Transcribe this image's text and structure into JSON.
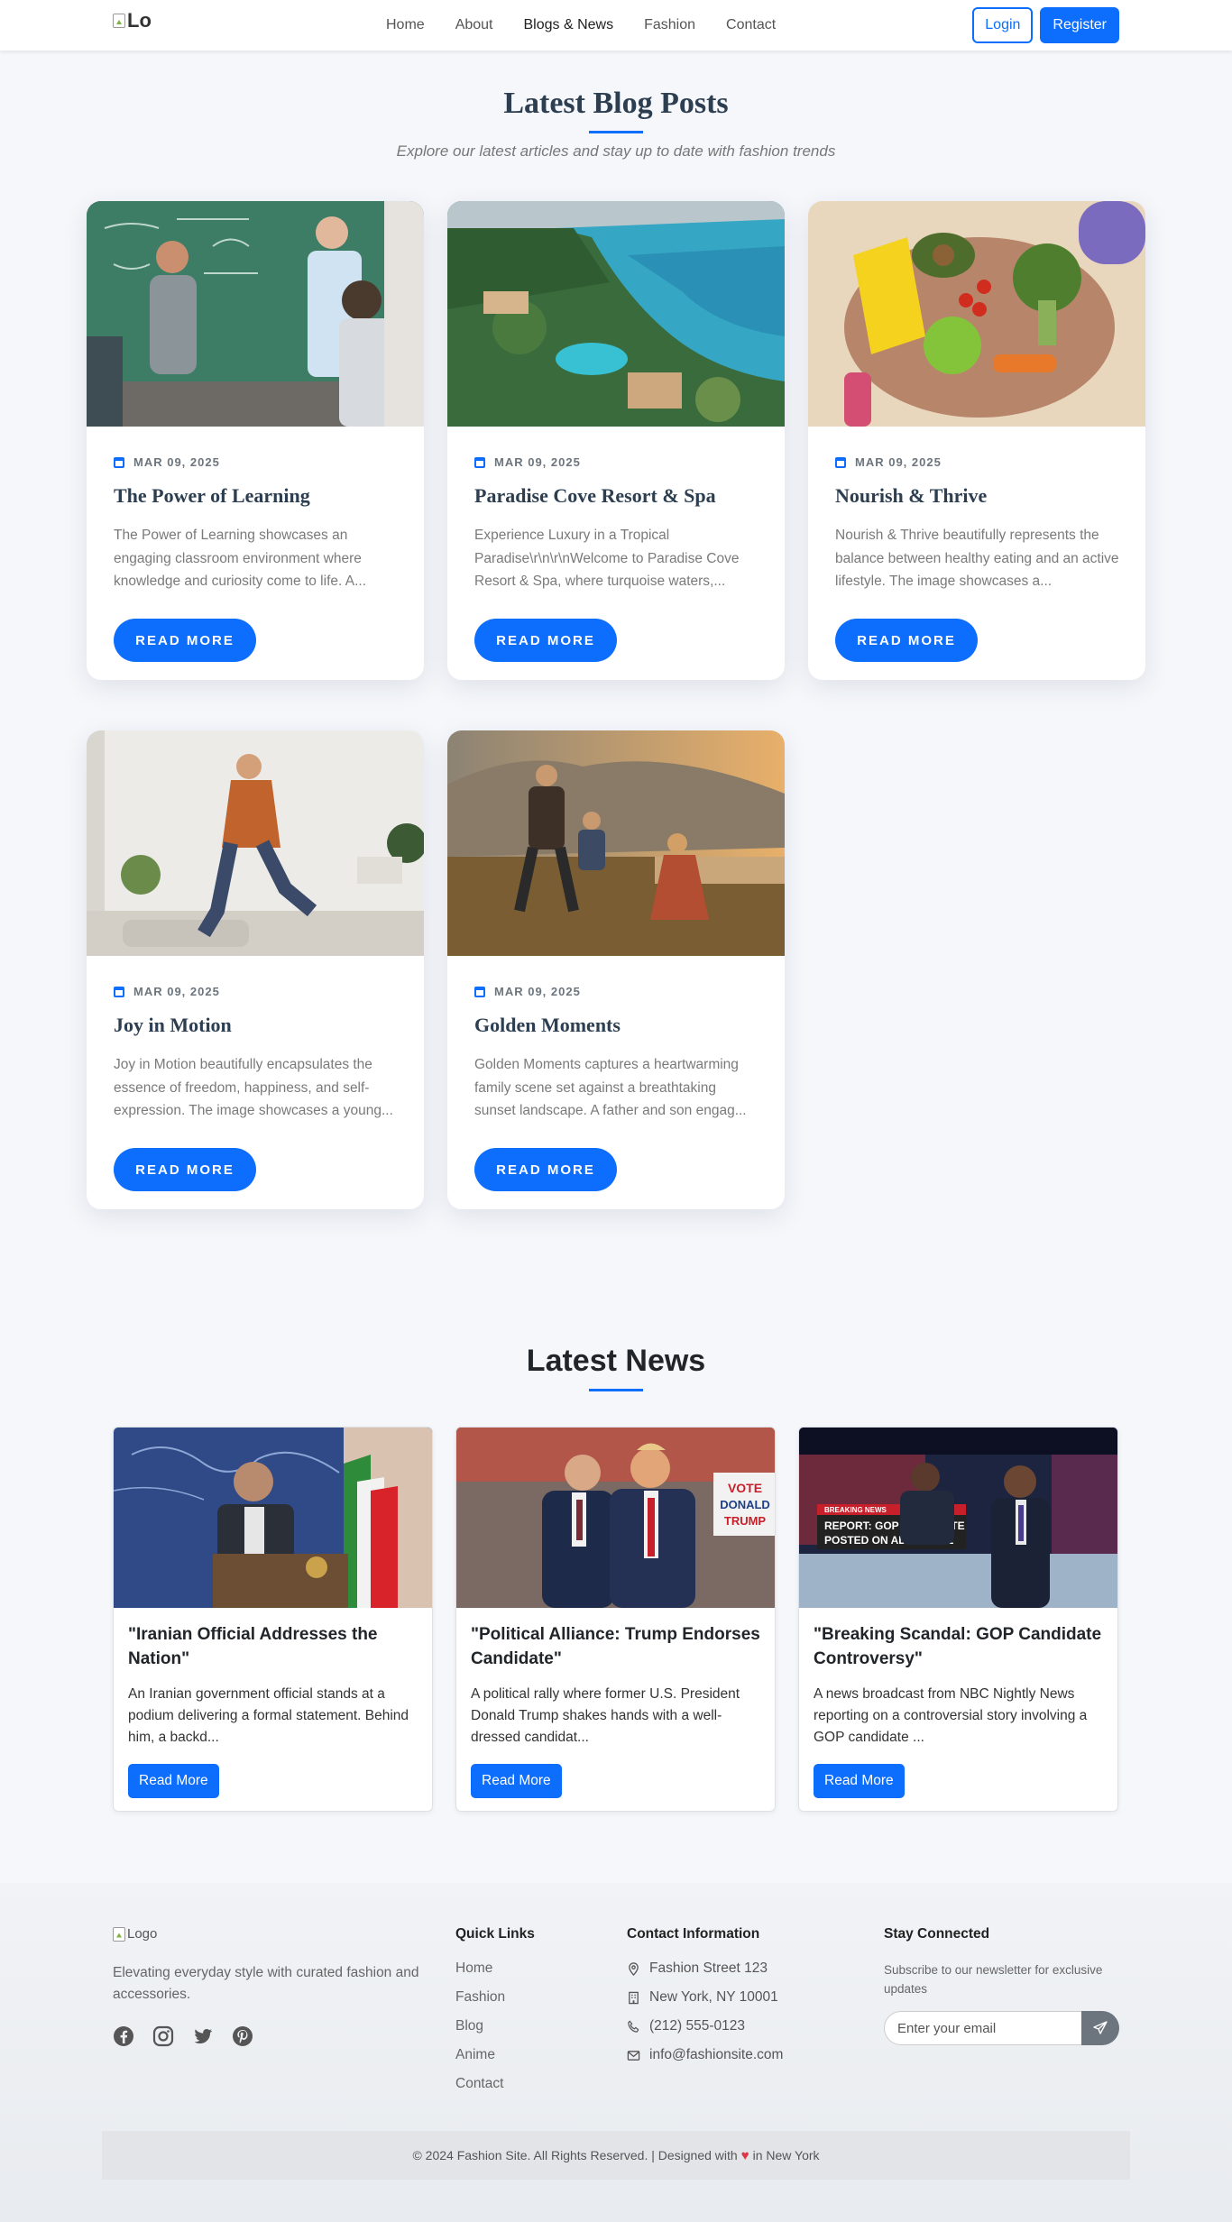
{
  "nav": {
    "logo_alt": "Lo",
    "links": [
      "Home",
      "About",
      "Blogs & News",
      "Fashion",
      "Contact"
    ],
    "login": "Login",
    "register": "Register"
  },
  "blog": {
    "title": "Latest Blog Posts",
    "subtitle": "Explore our latest articles and stay up to date with fashion trends",
    "read_more": "READ MORE",
    "posts": [
      {
        "date": "MAR 09, 2025",
        "title": "The Power of Learning",
        "excerpt": "The Power of Learning showcases an engaging classroom environment where knowledge and curiosity come to life. A..."
      },
      {
        "date": "MAR 09, 2025",
        "title": "Paradise Cove Resort & Spa",
        "excerpt": "Experience Luxury in a Tropical Paradise\\r\\n\\r\\nWelcome to Paradise Cove Resort & Spa, where turquoise waters,..."
      },
      {
        "date": "MAR 09, 2025",
        "title": "Nourish & Thrive",
        "excerpt": "Nourish & Thrive beautifully represents the balance between healthy eating and an active lifestyle. The image showcases a..."
      },
      {
        "date": "MAR 09, 2025",
        "title": "Joy in Motion",
        "excerpt": "Joy in Motion beautifully encapsulates the essence of freedom, happiness, and self-expression. The image showcases a young..."
      },
      {
        "date": "MAR 09, 2025",
        "title": "Golden Moments",
        "excerpt": "Golden Moments captures a heartwarming family scene set against a breathtaking sunset landscape. A father and son engag..."
      }
    ]
  },
  "news": {
    "title": "Latest News",
    "read_more": "Read More",
    "items": [
      {
        "title": "\"Iranian Official Addresses the Nation\"",
        "text": "An Iranian government official stands at a podium delivering a formal statement. Behind him, a backd..."
      },
      {
        "title": "\"Political Alliance: Trump Endorses Candidate\"",
        "text": "A political rally where former U.S. President Donald Trump shakes hands with a well-dressed candidat...",
        "image_sign": [
          "VOTE",
          "DONALD",
          "TRUMP"
        ]
      },
      {
        "title": "\"Breaking Scandal: GOP Candidate Controversy\"",
        "text": "A news broadcast from NBC Nightly News reporting on a controversial story involving a GOP candidate ...",
        "image_banner_top": "BREAKING NEWS",
        "image_banner": [
          "REPORT: GOP CANDIDATE",
          "POSTED ON ADULT SITE"
        ]
      }
    ]
  },
  "footer": {
    "logo_alt": "Logo",
    "tagline": "Elevating everyday style with curated fashion and accessories.",
    "quick_links_heading": "Quick Links",
    "quick_links": [
      "Home",
      "Fashion",
      "Blog",
      "Anime",
      "Contact"
    ],
    "contact_heading": "Contact Information",
    "contact": {
      "address": "Fashion Street 123",
      "city": "New York, NY 10001",
      "phone": "(212) 555-0123",
      "email": "info@fashionsite.com"
    },
    "stay_heading": "Stay Connected",
    "stay_text": "Subscribe to our newsletter for exclusive updates",
    "email_placeholder": "Enter your email",
    "copyright_pre": "© 2024 Fashion Site. All Rights Reserved. | Designed with",
    "copyright_post": "in New York"
  },
  "colors": {
    "primary": "#0d6efd",
    "heading": "#2c3e50",
    "heart": "#dc3545"
  }
}
